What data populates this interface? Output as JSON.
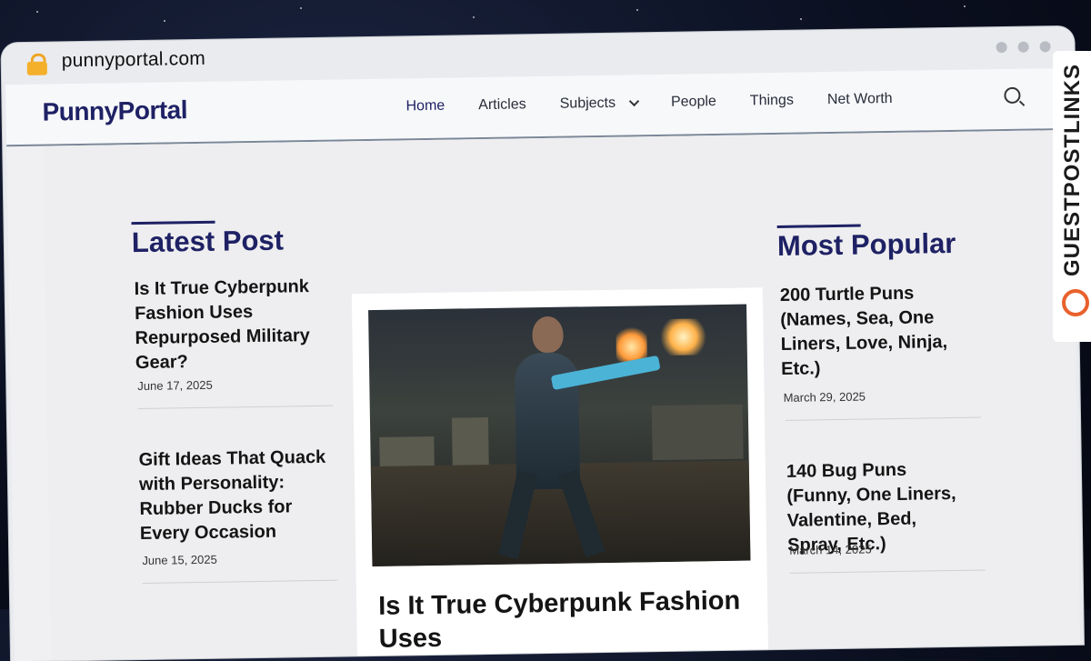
{
  "browser": {
    "url": "punnyportal.com"
  },
  "site": {
    "logo": "PunnyPortal",
    "nav": [
      "Home",
      "Articles",
      "Subjects",
      "People",
      "Things",
      "Net Worth"
    ]
  },
  "latest": {
    "heading": "Latest Post",
    "posts": [
      {
        "title": "Is It True Cyberpunk Fashion Uses Repurposed Military Gear?",
        "date": "June 17, 2025"
      },
      {
        "title": "Gift Ideas That Quack with Personality: Rubber Ducks for Every Occasion",
        "date": "June 15, 2025"
      }
    ]
  },
  "feature": {
    "title": "Is It True Cyberpunk Fashion Uses"
  },
  "popular": {
    "heading": "Most Popular",
    "posts": [
      {
        "title": "200 Turtle Puns (Names, Sea, One Liners, Love, Ninja, Etc.)",
        "date": "March 29, 2025"
      },
      {
        "title": "140 Bug Puns (Funny, One Liners, Valentine, Bed, Spray, Etc.)",
        "date": "March 14, 2025"
      }
    ]
  },
  "badge": {
    "text": "GUESTPOSTLINKS"
  }
}
